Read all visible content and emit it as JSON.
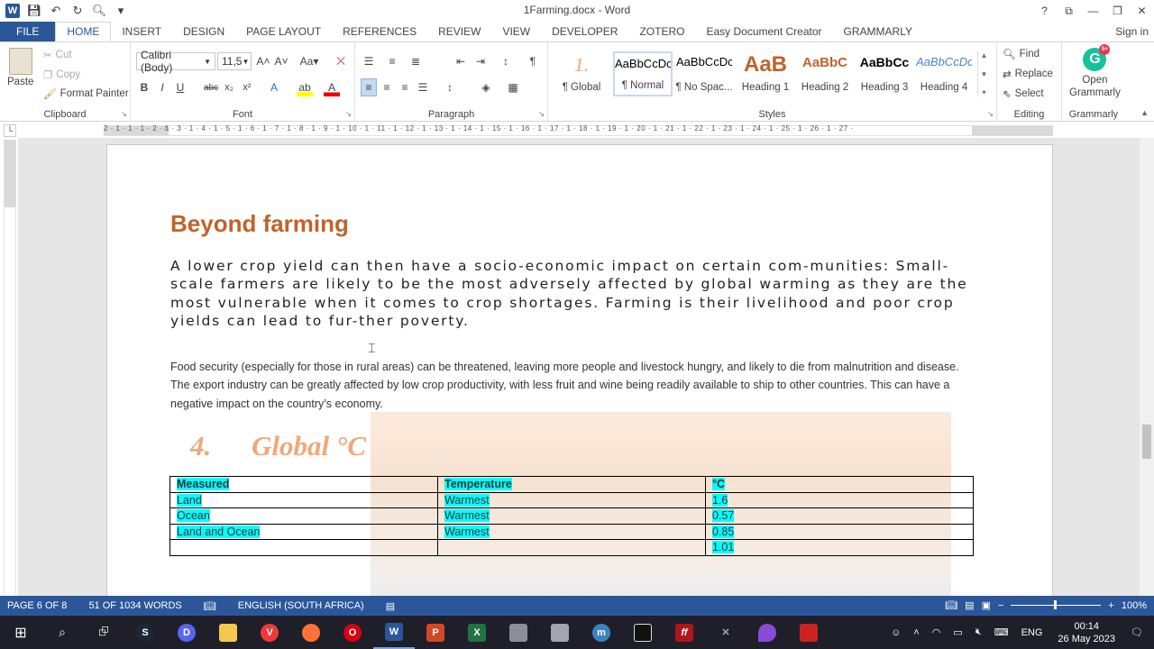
{
  "window": {
    "title": "1Farming.docx - Word",
    "controls": [
      "?",
      "⧉",
      "—",
      "❐",
      "✕"
    ]
  },
  "tabs": {
    "items": [
      "FILE",
      "HOME",
      "INSERT",
      "DESIGN",
      "PAGE LAYOUT",
      "REFERENCES",
      "REVIEW",
      "VIEW",
      "DEVELOPER",
      "ZOTERO",
      "Easy Document Creator",
      "GRAMMARLY"
    ],
    "active": "HOME",
    "signin": "Sign in"
  },
  "ribbon": {
    "clipboard": {
      "label": "Clipboard",
      "paste": "Paste",
      "cut": "Cut",
      "copy": "Copy",
      "format_painter": "Format Painter"
    },
    "font": {
      "label": "Font",
      "family": "Calibri (Body)",
      "size": "11,5"
    },
    "paragraph": {
      "label": "Paragraph"
    },
    "styles": {
      "label": "Styles",
      "items": [
        {
          "preview": "1.",
          "name": "¶ Global"
        },
        {
          "preview": "AaBbCcDc",
          "name": "¶ Normal"
        },
        {
          "preview": "AaBbCcDc",
          "name": "¶ No Spac..."
        },
        {
          "preview": "AaB",
          "name": "Heading 1"
        },
        {
          "preview": "AaBbC",
          "name": "Heading 2"
        },
        {
          "preview": "AaBbCc",
          "name": "Heading 3"
        },
        {
          "preview": "AaBbCcDc",
          "name": "Heading 4"
        }
      ]
    },
    "editing": {
      "label": "Editing",
      "find": "Find",
      "replace": "Replace",
      "select": "Select"
    },
    "grammarly": {
      "label": "Grammarly",
      "open": "Open\nGrammarly",
      "badge": "5+"
    }
  },
  "ruler": {
    "numbers": "2 · 1 · 1 · 1 · 2 · 1 · 3 · 1 · 4 · 1 · 5 · 1 · 6 · 1 · 7 · 1 · 8 · 1 · 9 · 1 · 10 · 1 · 11 · 1 · 12 · 1 · 13 · 1 · 14 · 1 · 15 · 1 · 16 · 1 · 17 · 1 · 18 · 1 · 19 · 1 · 20 · 1 · 21 · 1 · 22 · 1 · 23 · 1 · 24 · 1 · 25 · 1 · 26 · 1 · 27 ·"
  },
  "document": {
    "heading": "Beyond farming",
    "lead": "A lower crop yield can then have a socio-economic impact on certain com-munities: Small-scale farmers are likely to be the most adversely affected by global warming as they are the most vulnerable when it comes to crop shortages. Farming is their livelihood and poor crop yields can lead to fur-ther poverty.",
    "body": "Food security (especially for those in rural areas) can be threatened, leaving more people and livestock hungry, and likely to die from malnutrition and disease. The export industry can be greatly affected by low crop productivity, with less fruit and wine being readily available to ship to other countries. This can have a negative impact on the country’s economy.",
    "section_number": "4.",
    "section_title": "Global °C",
    "table": {
      "headers": [
        "Measured",
        "Temperature",
        "°C"
      ],
      "rows": [
        [
          "Land",
          "Warmest",
          "1.6"
        ],
        [
          "Ocean",
          "Warmest",
          "0.57"
        ],
        [
          "Land and Ocean",
          "Warmest",
          "0.85"
        ],
        [
          "",
          "",
          "1.01"
        ]
      ]
    }
  },
  "status": {
    "page": "PAGE 6 OF 8",
    "words": "51 OF 1034 WORDS",
    "language": "ENGLISH (SOUTH AFRICA)",
    "zoom": "100%"
  },
  "taskbar": {
    "lang": "ENG",
    "time": "00:14",
    "date": "26 May 2023"
  }
}
